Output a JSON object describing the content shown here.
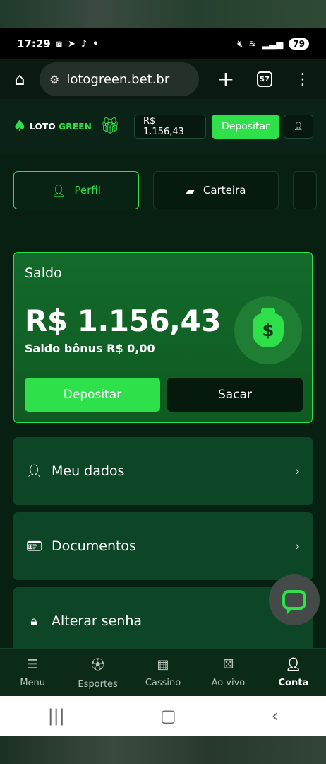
{
  "status_bar": {
    "time": "17:29",
    "battery": "79",
    "icons": [
      "screenshot-icon",
      "telegram-icon",
      "tiktok-icon",
      "dot-icon",
      "mute-icon",
      "wifi-icon",
      "signal-icon"
    ]
  },
  "browser": {
    "url": "lotogreen.bet.br",
    "tab_count": "57"
  },
  "header": {
    "logo_part1": "LOTO",
    "logo_part2": "GREEN",
    "balance": "R$ 1.156,43",
    "deposit_label": "Depositar"
  },
  "tabs": [
    {
      "label": "Perfil",
      "active": true
    },
    {
      "label": "Carteira",
      "active": false
    }
  ],
  "saldo": {
    "title": "Saldo",
    "amount": "R$ 1.156,43",
    "bonus": "Saldo bônus R$ 0,00",
    "deposit_label": "Depositar",
    "withdraw_label": "Sacar"
  },
  "menu": [
    {
      "label": "Meu dados",
      "icon": "user-icon"
    },
    {
      "label": "Documentos",
      "icon": "id-card-icon"
    },
    {
      "label": "Alterar senha",
      "icon": "user-lock-icon"
    }
  ],
  "bottom_nav": [
    {
      "label": "Menu",
      "icon": "hamburger-icon"
    },
    {
      "label": "Esportes",
      "icon": "soccer-ball-icon"
    },
    {
      "label": "Cassino",
      "icon": "slot-machine-icon"
    },
    {
      "label": "Ao vivo",
      "icon": "dice-icon"
    },
    {
      "label": "Conta",
      "icon": "user-icon",
      "active": true
    }
  ],
  "colors": {
    "accent": "#2ee04a",
    "card": "#136a2a",
    "menu_item": "#0d4527",
    "background": "#072012"
  }
}
